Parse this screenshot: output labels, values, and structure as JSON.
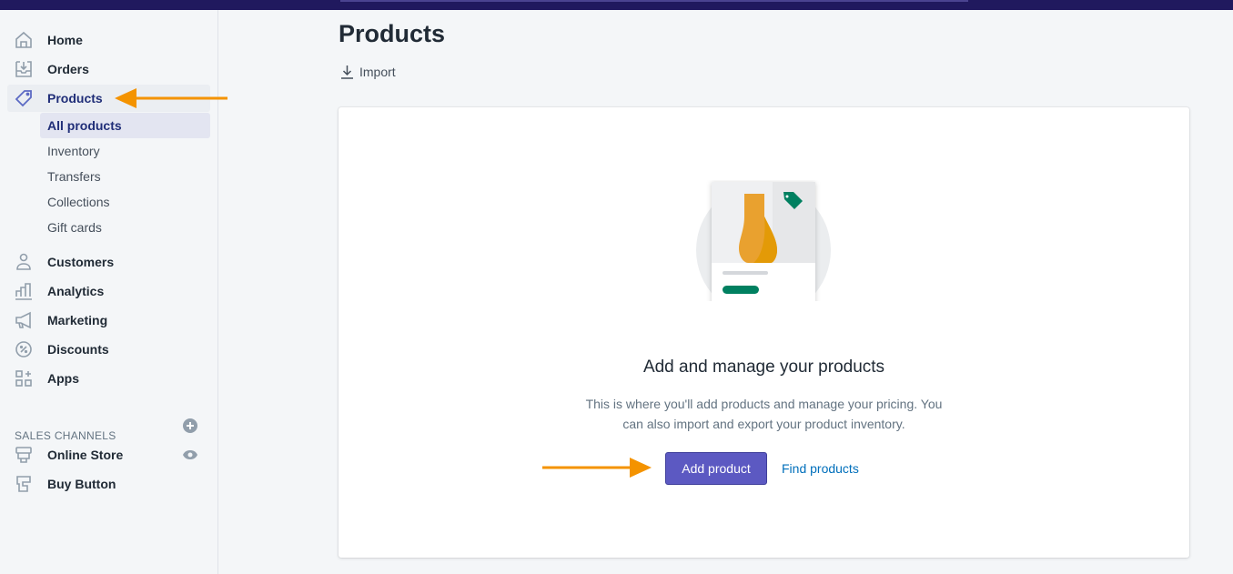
{
  "sidebar": {
    "items": [
      {
        "label": "Home",
        "icon": "home-icon"
      },
      {
        "label": "Orders",
        "icon": "orders-icon"
      },
      {
        "label": "Products",
        "icon": "tag-icon"
      }
    ],
    "sub_items": [
      {
        "label": "All products"
      },
      {
        "label": "Inventory"
      },
      {
        "label": "Transfers"
      },
      {
        "label": "Collections"
      },
      {
        "label": "Gift cards"
      }
    ],
    "items2": [
      {
        "label": "Customers",
        "icon": "customer-icon"
      },
      {
        "label": "Analytics",
        "icon": "analytics-icon"
      },
      {
        "label": "Marketing",
        "icon": "megaphone-icon"
      },
      {
        "label": "Discounts",
        "icon": "discount-icon"
      },
      {
        "label": "Apps",
        "icon": "apps-icon"
      }
    ],
    "section_label": "SALES CHANNELS",
    "channels": [
      {
        "label": "Online Store",
        "icon": "store-icon"
      },
      {
        "label": "Buy Button",
        "icon": "buy-button-icon"
      }
    ]
  },
  "main": {
    "title": "Products",
    "import_label": "Import",
    "empty_state": {
      "heading": "Add and manage your products",
      "description": "This is where you'll add products and manage your pricing. You can also import and export your product inventory.",
      "primary_button": "Add product",
      "secondary_link": "Find products"
    }
  },
  "colors": {
    "topbar": "#20195e",
    "primary": "#5c59c2",
    "annotation_arrow": "#f49300",
    "link": "#006fbb"
  }
}
